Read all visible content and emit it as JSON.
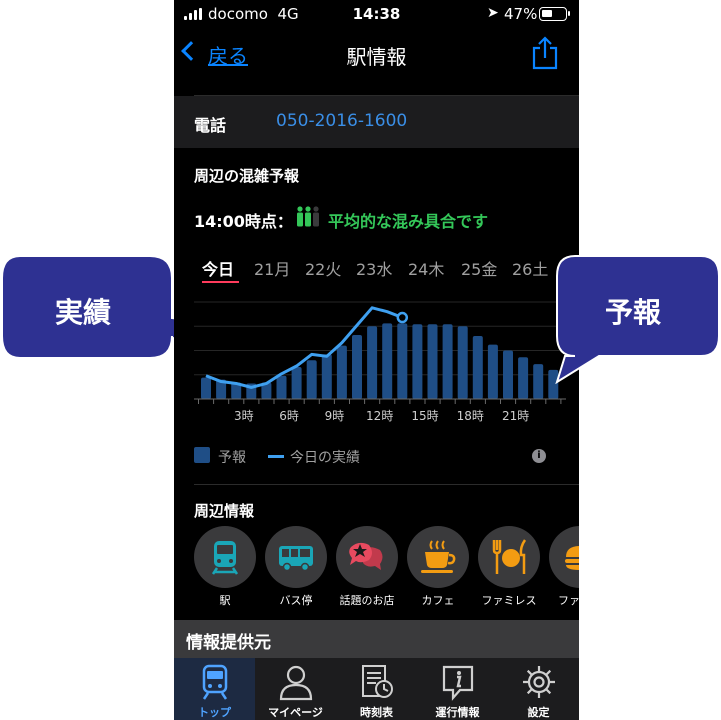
{
  "status_bar": {
    "carrier": "docomo",
    "network": "4G",
    "time": "14:38",
    "battery": "47%",
    "battery_level": 0.47
  },
  "nav": {
    "back_label": "戻る",
    "title": "駅情報"
  },
  "phone": {
    "label": "電話",
    "number": "050-2016-1600"
  },
  "congestion": {
    "title": "周辺の混雑予報",
    "time_label": "14:00時点：",
    "status": "平均的な混み具合です",
    "days": [
      "今日",
      "21月",
      "22火",
      "23水",
      "24木",
      "25金",
      "26土"
    ],
    "active_day": 0,
    "legend_forecast": "予報",
    "legend_actual": "今日の実績"
  },
  "chart_data": {
    "type": "bar",
    "categories": [
      "0",
      "1",
      "2",
      "3",
      "4",
      "5",
      "6",
      "7",
      "8",
      "9",
      "10",
      "11",
      "12",
      "13",
      "14",
      "15",
      "16",
      "17",
      "18",
      "19",
      "20",
      "21",
      "22",
      "23"
    ],
    "x_tick_labels": [
      "3時",
      "6時",
      "9時",
      "12時",
      "15時",
      "18時",
      "21時"
    ],
    "x_tick_hours": [
      3,
      6,
      9,
      12,
      15,
      18,
      21
    ],
    "ylim": [
      0,
      100
    ],
    "grid": true,
    "series": [
      {
        "name": "予報",
        "values": [
          22,
          20,
          17,
          16,
          17,
          24,
          33,
          40,
          46,
          55,
          66,
          75,
          78,
          78,
          77,
          77,
          77,
          75,
          65,
          56,
          50,
          43,
          36,
          30
        ]
      },
      {
        "name": "今日の実績",
        "values": [
          24,
          18,
          16,
          12,
          16,
          26,
          34,
          46,
          44,
          58,
          76,
          94,
          90,
          84
        ]
      }
    ]
  },
  "nearby": {
    "title": "周辺情報",
    "items": [
      {
        "label": "駅",
        "icon": "train-icon",
        "color": "#1aa6b7"
      },
      {
        "label": "バス停",
        "icon": "bus-icon",
        "color": "#1aa6b7"
      },
      {
        "label": "話題のお店",
        "icon": "star-chat-icon",
        "color": "#e84a5f"
      },
      {
        "label": "カフェ",
        "icon": "coffee-cup-icon",
        "color": "#f39c12"
      },
      {
        "label": "ファミレス",
        "icon": "fork-knife-icon",
        "color": "#f39c12"
      },
      {
        "label": "ファスト",
        "icon": "burger-icon",
        "color": "#f39c12"
      }
    ]
  },
  "provider": {
    "label": "情報提供元"
  },
  "tabs": [
    {
      "label": "トップ",
      "icon": "train-icon"
    },
    {
      "label": "マイページ",
      "icon": "person-icon"
    },
    {
      "label": "時刻表",
      "icon": "timetable-icon"
    },
    {
      "label": "運行情報",
      "icon": "info-icon"
    },
    {
      "label": "設定",
      "icon": "gear-icon"
    }
  ],
  "active_tab": 0,
  "callouts": {
    "actual": "実績",
    "forecast": "予報"
  },
  "colors": {
    "accent_blue": "#0a84ff",
    "status_green": "#34c759",
    "bar_fill": "#1f4e86",
    "actual_line": "#3fa0f0",
    "callout_fill": "#2e3192",
    "active_underline": "#ff3b5c"
  }
}
